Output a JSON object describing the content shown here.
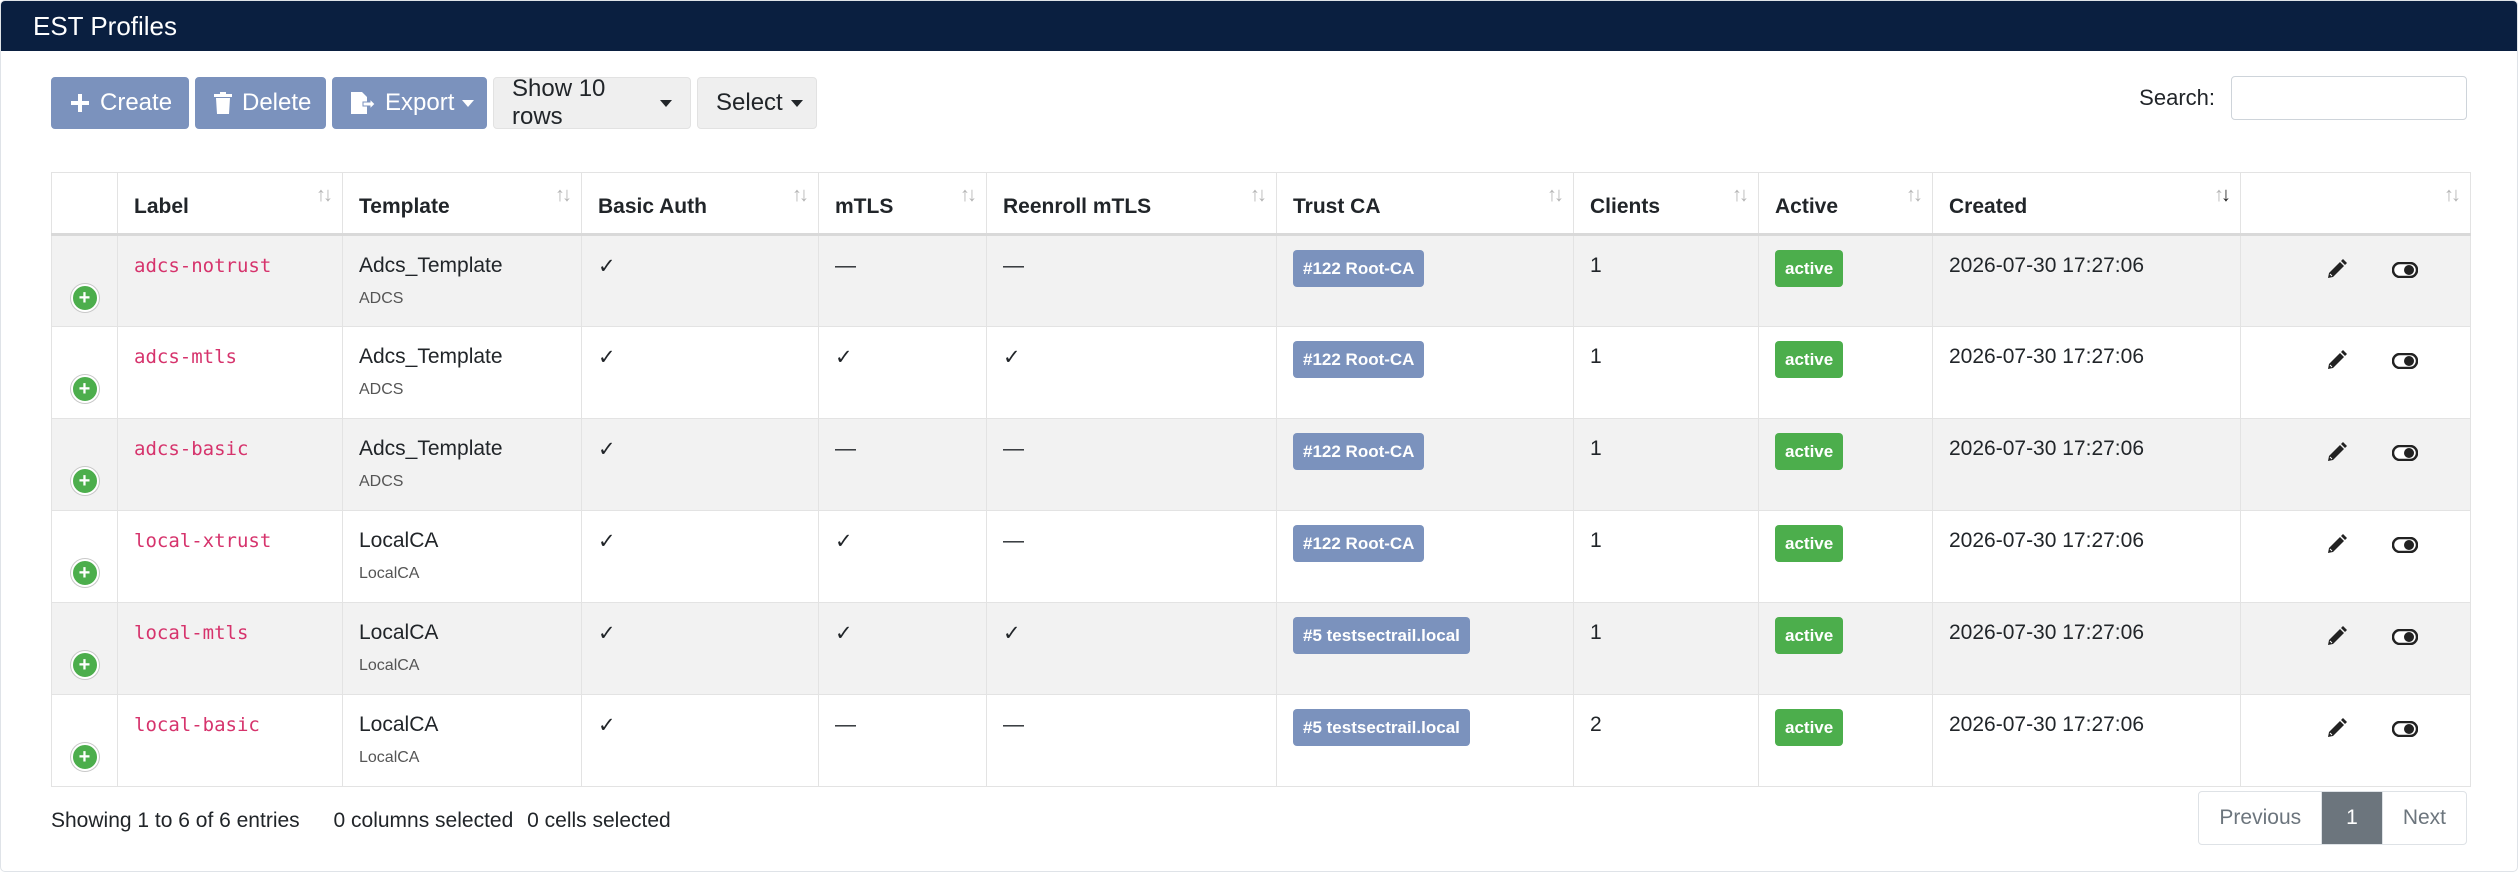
{
  "header": {
    "title": "EST Profiles"
  },
  "toolbar": {
    "create_label": "Create",
    "delete_label": "Delete",
    "export_label": "Export",
    "rows_label": "Show 10 rows",
    "select_label": "Select"
  },
  "search": {
    "label": "Search:",
    "value": "",
    "placeholder": ""
  },
  "table": {
    "columns": [
      "Label",
      "Template",
      "Basic Auth",
      "mTLS",
      "Reenroll mTLS",
      "Trust CA",
      "Clients",
      "Active",
      "Created"
    ],
    "rows": [
      {
        "label": "adcs-notrust",
        "template": "Adcs_Template",
        "template_sub": "ADCS",
        "basic_auth": "✓",
        "mtls": "—",
        "reenroll": "—",
        "trust_ca": "#122 Root-CA",
        "clients": "1",
        "active": "active",
        "created": "2026-07-30 17:27:06"
      },
      {
        "label": "adcs-mtls",
        "template": "Adcs_Template",
        "template_sub": "ADCS",
        "basic_auth": "✓",
        "mtls": "✓",
        "reenroll": "✓",
        "trust_ca": "#122 Root-CA",
        "clients": "1",
        "active": "active",
        "created": "2026-07-30 17:27:06"
      },
      {
        "label": "adcs-basic",
        "template": "Adcs_Template",
        "template_sub": "ADCS",
        "basic_auth": "✓",
        "mtls": "—",
        "reenroll": "—",
        "trust_ca": "#122 Root-CA",
        "clients": "1",
        "active": "active",
        "created": "2026-07-30 17:27:06"
      },
      {
        "label": "local-xtrust",
        "template": "LocalCA",
        "template_sub": "LocalCA",
        "basic_auth": "✓",
        "mtls": "✓",
        "reenroll": "—",
        "trust_ca": "#122 Root-CA",
        "clients": "1",
        "active": "active",
        "created": "2026-07-30 17:27:06"
      },
      {
        "label": "local-mtls",
        "template": "LocalCA",
        "template_sub": "LocalCA",
        "basic_auth": "✓",
        "mtls": "✓",
        "reenroll": "✓",
        "trust_ca": "#5 testsectrail.local",
        "clients": "1",
        "active": "active",
        "created": "2026-07-30 17:27:06"
      },
      {
        "label": "local-basic",
        "template": "LocalCA",
        "template_sub": "LocalCA",
        "basic_auth": "✓",
        "mtls": "—",
        "reenroll": "—",
        "trust_ca": "#5 testsectrail.local",
        "clients": "2",
        "active": "active",
        "created": "2026-07-30 17:27:06"
      }
    ]
  },
  "footer": {
    "entries": "Showing 1 to 6 of 6 entries",
    "columns_selected": "0 columns selected",
    "cells_selected": "0 cells selected"
  },
  "pagination": {
    "previous": "Previous",
    "current": "1",
    "next": "Next"
  },
  "colors": {
    "header_bg": "#0a1f40",
    "primary": "#7b92bd",
    "success": "#4cae4c",
    "code": "#d6336c"
  }
}
